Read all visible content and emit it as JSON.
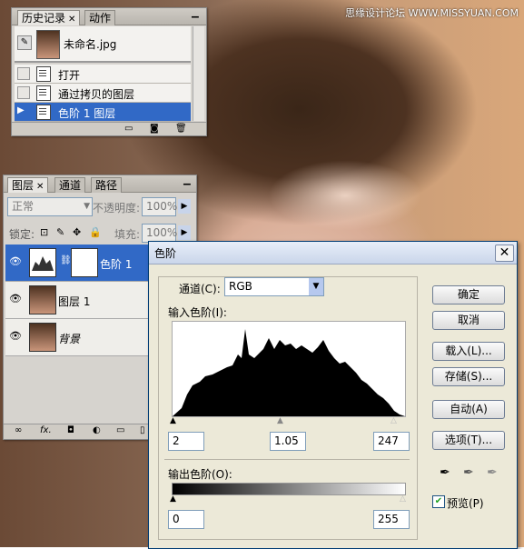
{
  "watermark": "思缘设计论坛  WWW.MISSYUAN.COM",
  "history": {
    "tabs": [
      "历史记录",
      "动作"
    ],
    "source": "未命名.jpg",
    "items": [
      "打开",
      "通过拷贝的图层",
      "色阶 1 图层"
    ]
  },
  "layers": {
    "tabs": [
      "图层",
      "通道",
      "路径"
    ],
    "blend_mode": "正常",
    "opacity_label": "不透明度:",
    "opacity_value": "100%",
    "lock_label": "锁定:",
    "fill_label": "填充:",
    "fill_value": "100%",
    "rows": [
      {
        "name": "色阶 1"
      },
      {
        "name": "图层 1"
      },
      {
        "name": "背景"
      }
    ]
  },
  "levels": {
    "title": "色阶",
    "channel_label": "通道(C):",
    "channel_value": "RGB",
    "input_label": "输入色阶(I):",
    "input_black": "2",
    "input_gamma": "1.05",
    "input_white": "247",
    "output_label": "输出色阶(O):",
    "output_black": "0",
    "output_white": "255",
    "buttons": {
      "ok": "确定",
      "cancel": "取消",
      "load": "载入(L)...",
      "save": "存储(S)...",
      "auto": "自动(A)",
      "options": "选项(T)..."
    },
    "preview_label": "预览(P)"
  }
}
